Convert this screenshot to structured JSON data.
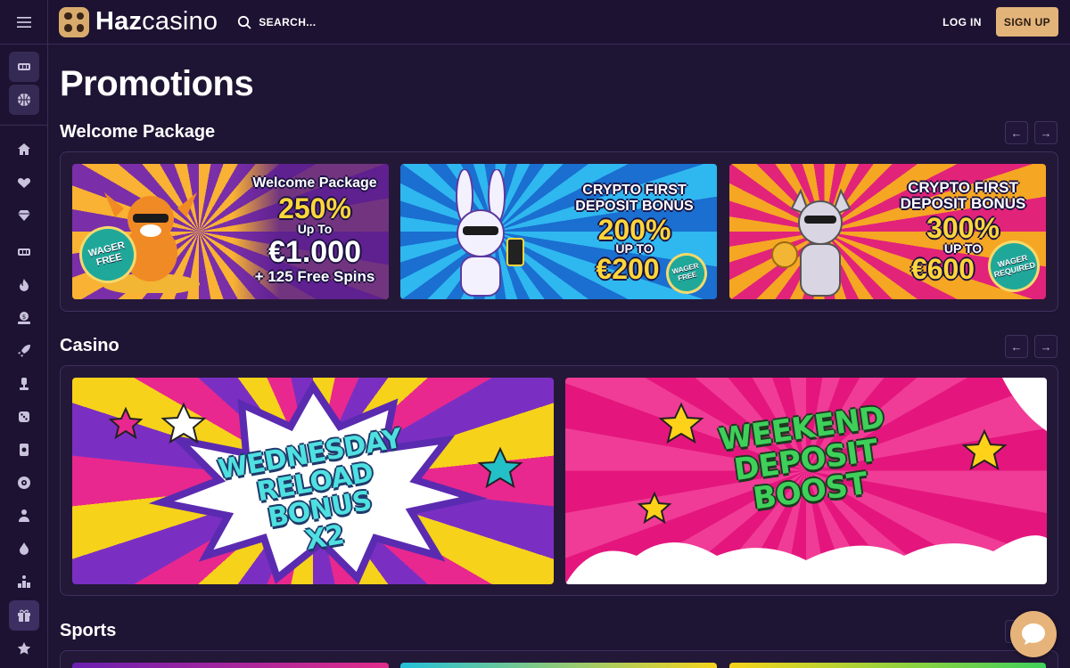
{
  "header": {
    "brand_bold": "Haz",
    "brand_light": "casino",
    "search_label": "SEARCH...",
    "login_label": "LOG IN",
    "signup_label": "SIGN UP"
  },
  "page_title": "Promotions",
  "sections": {
    "welcome": {
      "title": "Welcome Package",
      "banners": [
        {
          "line1": "Welcome Package",
          "line2": "250%",
          "line3": "Up To",
          "line4": "€1.000",
          "line5": "+ 125 Free Spins",
          "badge": "WAGER FREE"
        },
        {
          "line1": "CRYPTO FIRST",
          "line2": "DEPOSIT BONUS",
          "line3": "200%",
          "line4": "UP TO",
          "line5": "€200",
          "badge": "WAGER FREE"
        },
        {
          "line1": "CRYPTO FIRST",
          "line2": "DEPOSIT BONUS",
          "line3": "300%",
          "line4": "UP TO",
          "line5": "€600",
          "badge": "WAGER REQUIRED"
        }
      ]
    },
    "casino": {
      "title": "Casino",
      "banners": [
        {
          "line1": "WEDNESDAY",
          "line2": "RELOAD BONUS",
          "line3": "X2"
        },
        {
          "line1": "WEEKEND",
          "line2": "DEPOSIT",
          "line3": "BOOST"
        }
      ]
    },
    "sports": {
      "title": "Sports"
    }
  },
  "colors": {
    "background": "#1e1433",
    "accent": "#e3b47a",
    "panel": "#241838"
  },
  "icons": {
    "sidebar": [
      "slots-icon",
      "basketball-icon",
      "home-icon",
      "heart-icon",
      "diamond-icon",
      "slots-icon",
      "flame-icon",
      "money-icon",
      "rocket-icon",
      "trophy-icon",
      "dice-icon",
      "joker-icon",
      "roulette-icon",
      "dealer-icon",
      "drop-icon",
      "podium-icon",
      "gift-icon",
      "star-icon"
    ]
  }
}
